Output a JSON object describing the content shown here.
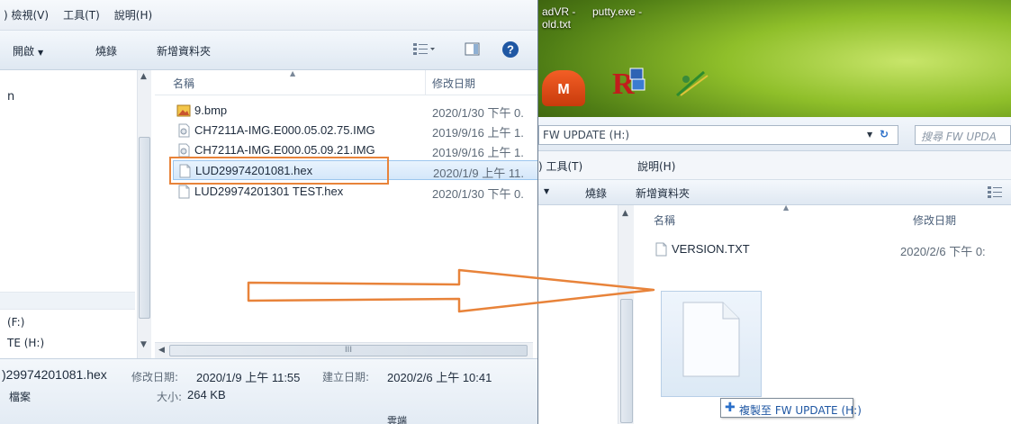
{
  "left_window": {
    "menu": [
      ") 檢視(V)",
      "工具(T)",
      "說明(H)"
    ],
    "toolbar": {
      "open_label": "開啟",
      "burn_label": "燒錄",
      "new_folder_label": "新增資料夾"
    },
    "nav_items": [
      "n",
      "(F:)",
      "TE (H:)"
    ],
    "columns": {
      "name": "名稱",
      "date": "修改日期"
    },
    "files": [
      {
        "name": "9.bmp",
        "date": "2020/1/30 下午 0.",
        "icon": "bitmap-file-icon"
      },
      {
        "name": "CH7211A-IMG.E000.05.02.75.IMG",
        "date": "2019/9/16 上午 1.",
        "icon": "disc-image-file-icon"
      },
      {
        "name": "CH7211A-IMG.E000.05.09.21.IMG",
        "date": "2019/9/16 上午 1.",
        "icon": "disc-image-file-icon"
      },
      {
        "name": "LUD29974201081.hex",
        "date": "2020/1/9 上午 11.",
        "icon": "hex-file-icon",
        "selected": true
      },
      {
        "name": "LUD29974201301 TEST.hex",
        "date": "2020/1/30 下午 0.",
        "icon": "hex-file-icon"
      }
    ],
    "hscroll_grip": "III",
    "details": {
      "filename": ")29974201081.hex",
      "modified_label": "修改日期:",
      "modified_value": "2020/1/9 上午 11:55",
      "created_label": "建立日期:",
      "created_value": "2020/2/6 上午 10:41",
      "type": "檔案",
      "size_label": "大小:",
      "size_value": "264 KB",
      "extra": "雲端"
    }
  },
  "desktop": {
    "labels": [
      "adVR -",
      "old.txt",
      "putty.exe -"
    ]
  },
  "right_window": {
    "address": "FW UPDATE (H:)",
    "search_placeholder": "搜尋 FW UPDA",
    "menu": [
      ") 工具(T)",
      "說明(H)"
    ],
    "toolbar": {
      "burn_label": "燒錄",
      "new_folder_label": "新增資料夾"
    },
    "columns": {
      "name": "名稱",
      "date": "修改日期"
    },
    "files": [
      {
        "name": "VERSION.TXT",
        "date": "2020/2/6 下午 0:",
        "icon": "text-file-icon"
      }
    ],
    "copy_tooltip": "複製至 FW UPDATE (H:)"
  },
  "colors": {
    "selection_border": "#9cc6ee",
    "annotation": "#e8833a",
    "link_blue": "#1f57a3"
  }
}
